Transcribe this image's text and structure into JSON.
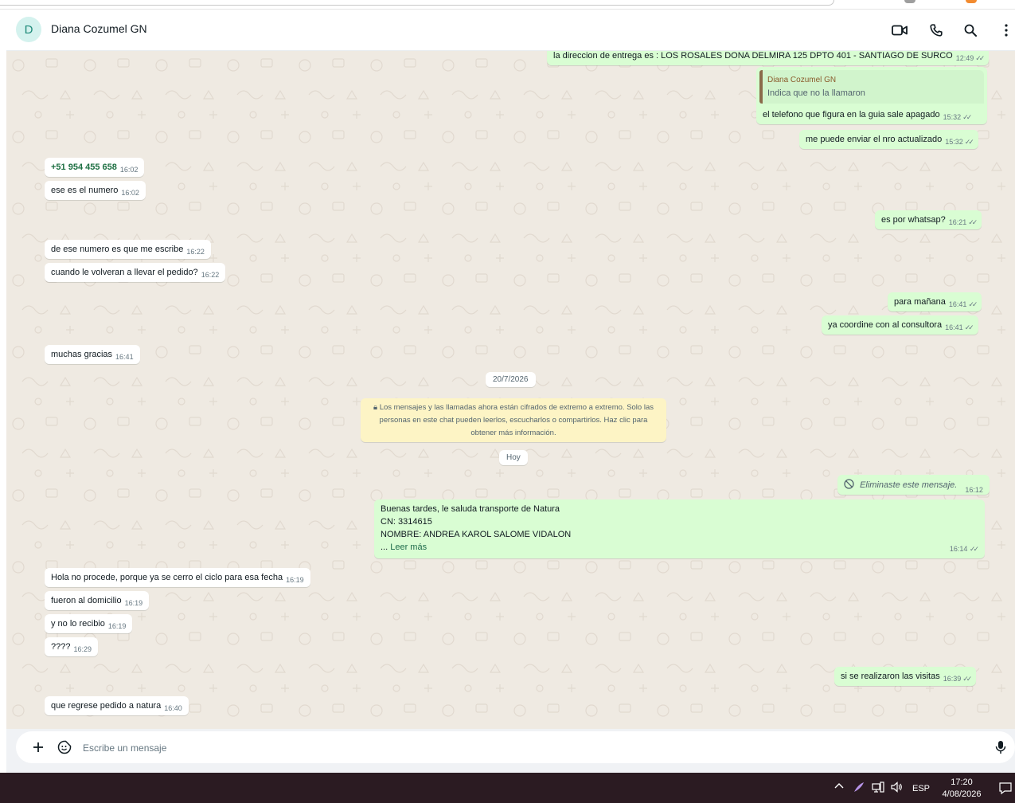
{
  "chat": {
    "contact_name": "Diana Cozumel GN",
    "avatar_initial": "D",
    "messages": [
      {
        "dir": "out",
        "text": "la direccion de entrega es : LOS ROSALES DONA DELMIRA 125 DPTO 401 - SANTIAGO DE SURCO",
        "time": "12:49"
      },
      {
        "dir": "out",
        "quote_author": "Diana Cozumel GN",
        "quote_text": "Indica  que no la llamaron",
        "text": "el telefono que figura en la guia sale apagado",
        "time": "15:32"
      },
      {
        "dir": "out",
        "text": "me puede enviar el nro actualizado",
        "time": "15:32"
      },
      {
        "dir": "in",
        "text": "+51 954 455 658",
        "time": "16:02"
      },
      {
        "dir": "in",
        "text": "ese es el numero",
        "time": "16:02"
      },
      {
        "dir": "out",
        "text": "es por whatsap?",
        "time": "16:21"
      },
      {
        "dir": "in",
        "text": "de ese numero es que me escribe",
        "time": "16:22"
      },
      {
        "dir": "in",
        "text": "cuando le volveran a llevar el pedido?",
        "time": "16:22"
      },
      {
        "dir": "out",
        "text": "para mañana",
        "time": "16:41"
      },
      {
        "dir": "out",
        "text": "ya coordine con al consultora",
        "time": "16:41"
      },
      {
        "dir": "in",
        "text": "muchas gracias",
        "time": "16:41"
      },
      {
        "dir": "out",
        "text": "Eliminaste este mensaje.",
        "time": "16:12"
      },
      {
        "dir": "out",
        "line1": "Buenas tardes, le saluda transporte de Natura",
        "line2": "CN: 3314615",
        "line3": "NOMBRE: ANDREA KAROL SALOME VIDALON",
        "ellipsis": "... ",
        "read_more": "Leer más",
        "time": "16:14"
      },
      {
        "dir": "in",
        "text": "Hola no procede, porque ya se cerro el ciclo para esa fecha",
        "time": "16:19"
      },
      {
        "dir": "in",
        "text": "fueron al domicilio",
        "time": "16:19"
      },
      {
        "dir": "in",
        "text": "y no lo recibio",
        "time": "16:19"
      },
      {
        "dir": "in",
        "text": "????",
        "time": "16:29"
      },
      {
        "dir": "out",
        "text": "si se realizaron las visitas",
        "time": "16:39"
      },
      {
        "dir": "in",
        "text": "que regrese pedido a natura",
        "time": "16:40"
      }
    ],
    "date_separator": "20/7/2026",
    "today_separator": "Hoy",
    "encryption_line1": "Los mensajes y las llamadas ahora están cifrados de extremo a extremo. Solo las",
    "encryption_line2": "personas en este chat pueden leerlos, escucharlos o compartirlos. Haz clic para",
    "encryption_line3": "obtener más información."
  },
  "composer": {
    "placeholder": "Escribe un mensaje"
  },
  "taskbar": {
    "lang": "ESP",
    "time": "17:20",
    "date": "4/08/2026"
  },
  "colors": {
    "outgoing_bubble": "#d9fdd3",
    "incoming_bubble": "#ffffff",
    "chat_background": "#efeae2",
    "system_note": "#fdf4c5",
    "taskbar": "#2b1b22"
  }
}
